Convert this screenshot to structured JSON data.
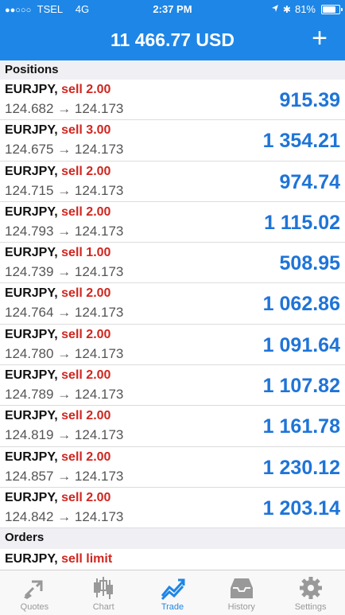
{
  "status": {
    "signal_dots": "●●○○○",
    "carrier": "TSEL",
    "network": "4G",
    "time": "2:37 PM",
    "battery": "81%"
  },
  "header": {
    "balance": "11 466.77 USD",
    "add_label": "+"
  },
  "positions": {
    "title": "Positions",
    "items": [
      {
        "symbol": "EURJPY,",
        "side": "sell 2.00",
        "open": "124.682",
        "arrow": "→",
        "current": "124.173",
        "profit": "915.39"
      },
      {
        "symbol": "EURJPY,",
        "side": "sell 3.00",
        "open": "124.675",
        "arrow": "→",
        "current": "124.173",
        "profit": "1 354.21"
      },
      {
        "symbol": "EURJPY,",
        "side": "sell 2.00",
        "open": "124.715",
        "arrow": "→",
        "current": "124.173",
        "profit": "974.74"
      },
      {
        "symbol": "EURJPY,",
        "side": "sell 2.00",
        "open": "124.793",
        "arrow": "→",
        "current": "124.173",
        "profit": "1 115.02"
      },
      {
        "symbol": "EURJPY,",
        "side": "sell 1.00",
        "open": "124.739",
        "arrow": "→",
        "current": "124.173",
        "profit": "508.95"
      },
      {
        "symbol": "EURJPY,",
        "side": "sell 2.00",
        "open": "124.764",
        "arrow": "→",
        "current": "124.173",
        "profit": "1 062.86"
      },
      {
        "symbol": "EURJPY,",
        "side": "sell 2.00",
        "open": "124.780",
        "arrow": "→",
        "current": "124.173",
        "profit": "1 091.64"
      },
      {
        "symbol": "EURJPY,",
        "side": "sell 2.00",
        "open": "124.789",
        "arrow": "→",
        "current": "124.173",
        "profit": "1 107.82"
      },
      {
        "symbol": "EURJPY,",
        "side": "sell 2.00",
        "open": "124.819",
        "arrow": "→",
        "current": "124.173",
        "profit": "1 161.78"
      },
      {
        "symbol": "EURJPY,",
        "side": "sell 2.00",
        "open": "124.857",
        "arrow": "→",
        "current": "124.173",
        "profit": "1 230.12"
      },
      {
        "symbol": "EURJPY,",
        "side": "sell 2.00",
        "open": "124.842",
        "arrow": "→",
        "current": "124.173",
        "profit": "1 203.14"
      }
    ]
  },
  "orders": {
    "title": "Orders",
    "items": [
      {
        "symbol": "EURJPY,",
        "side": "sell limit"
      }
    ]
  },
  "tabs": [
    {
      "label": "Quotes",
      "icon": "quotes-icon",
      "active": false
    },
    {
      "label": "Chart",
      "icon": "chart-icon",
      "active": false
    },
    {
      "label": "Trade",
      "icon": "trade-icon",
      "active": true
    },
    {
      "label": "History",
      "icon": "history-icon",
      "active": false
    },
    {
      "label": "Settings",
      "icon": "settings-icon",
      "active": false
    }
  ],
  "colors": {
    "header_bg": "#1e86e6",
    "sell": "#d0261f",
    "profit": "#1e74d8",
    "tab_active": "#1e86e6",
    "tab_inactive": "#999999"
  }
}
